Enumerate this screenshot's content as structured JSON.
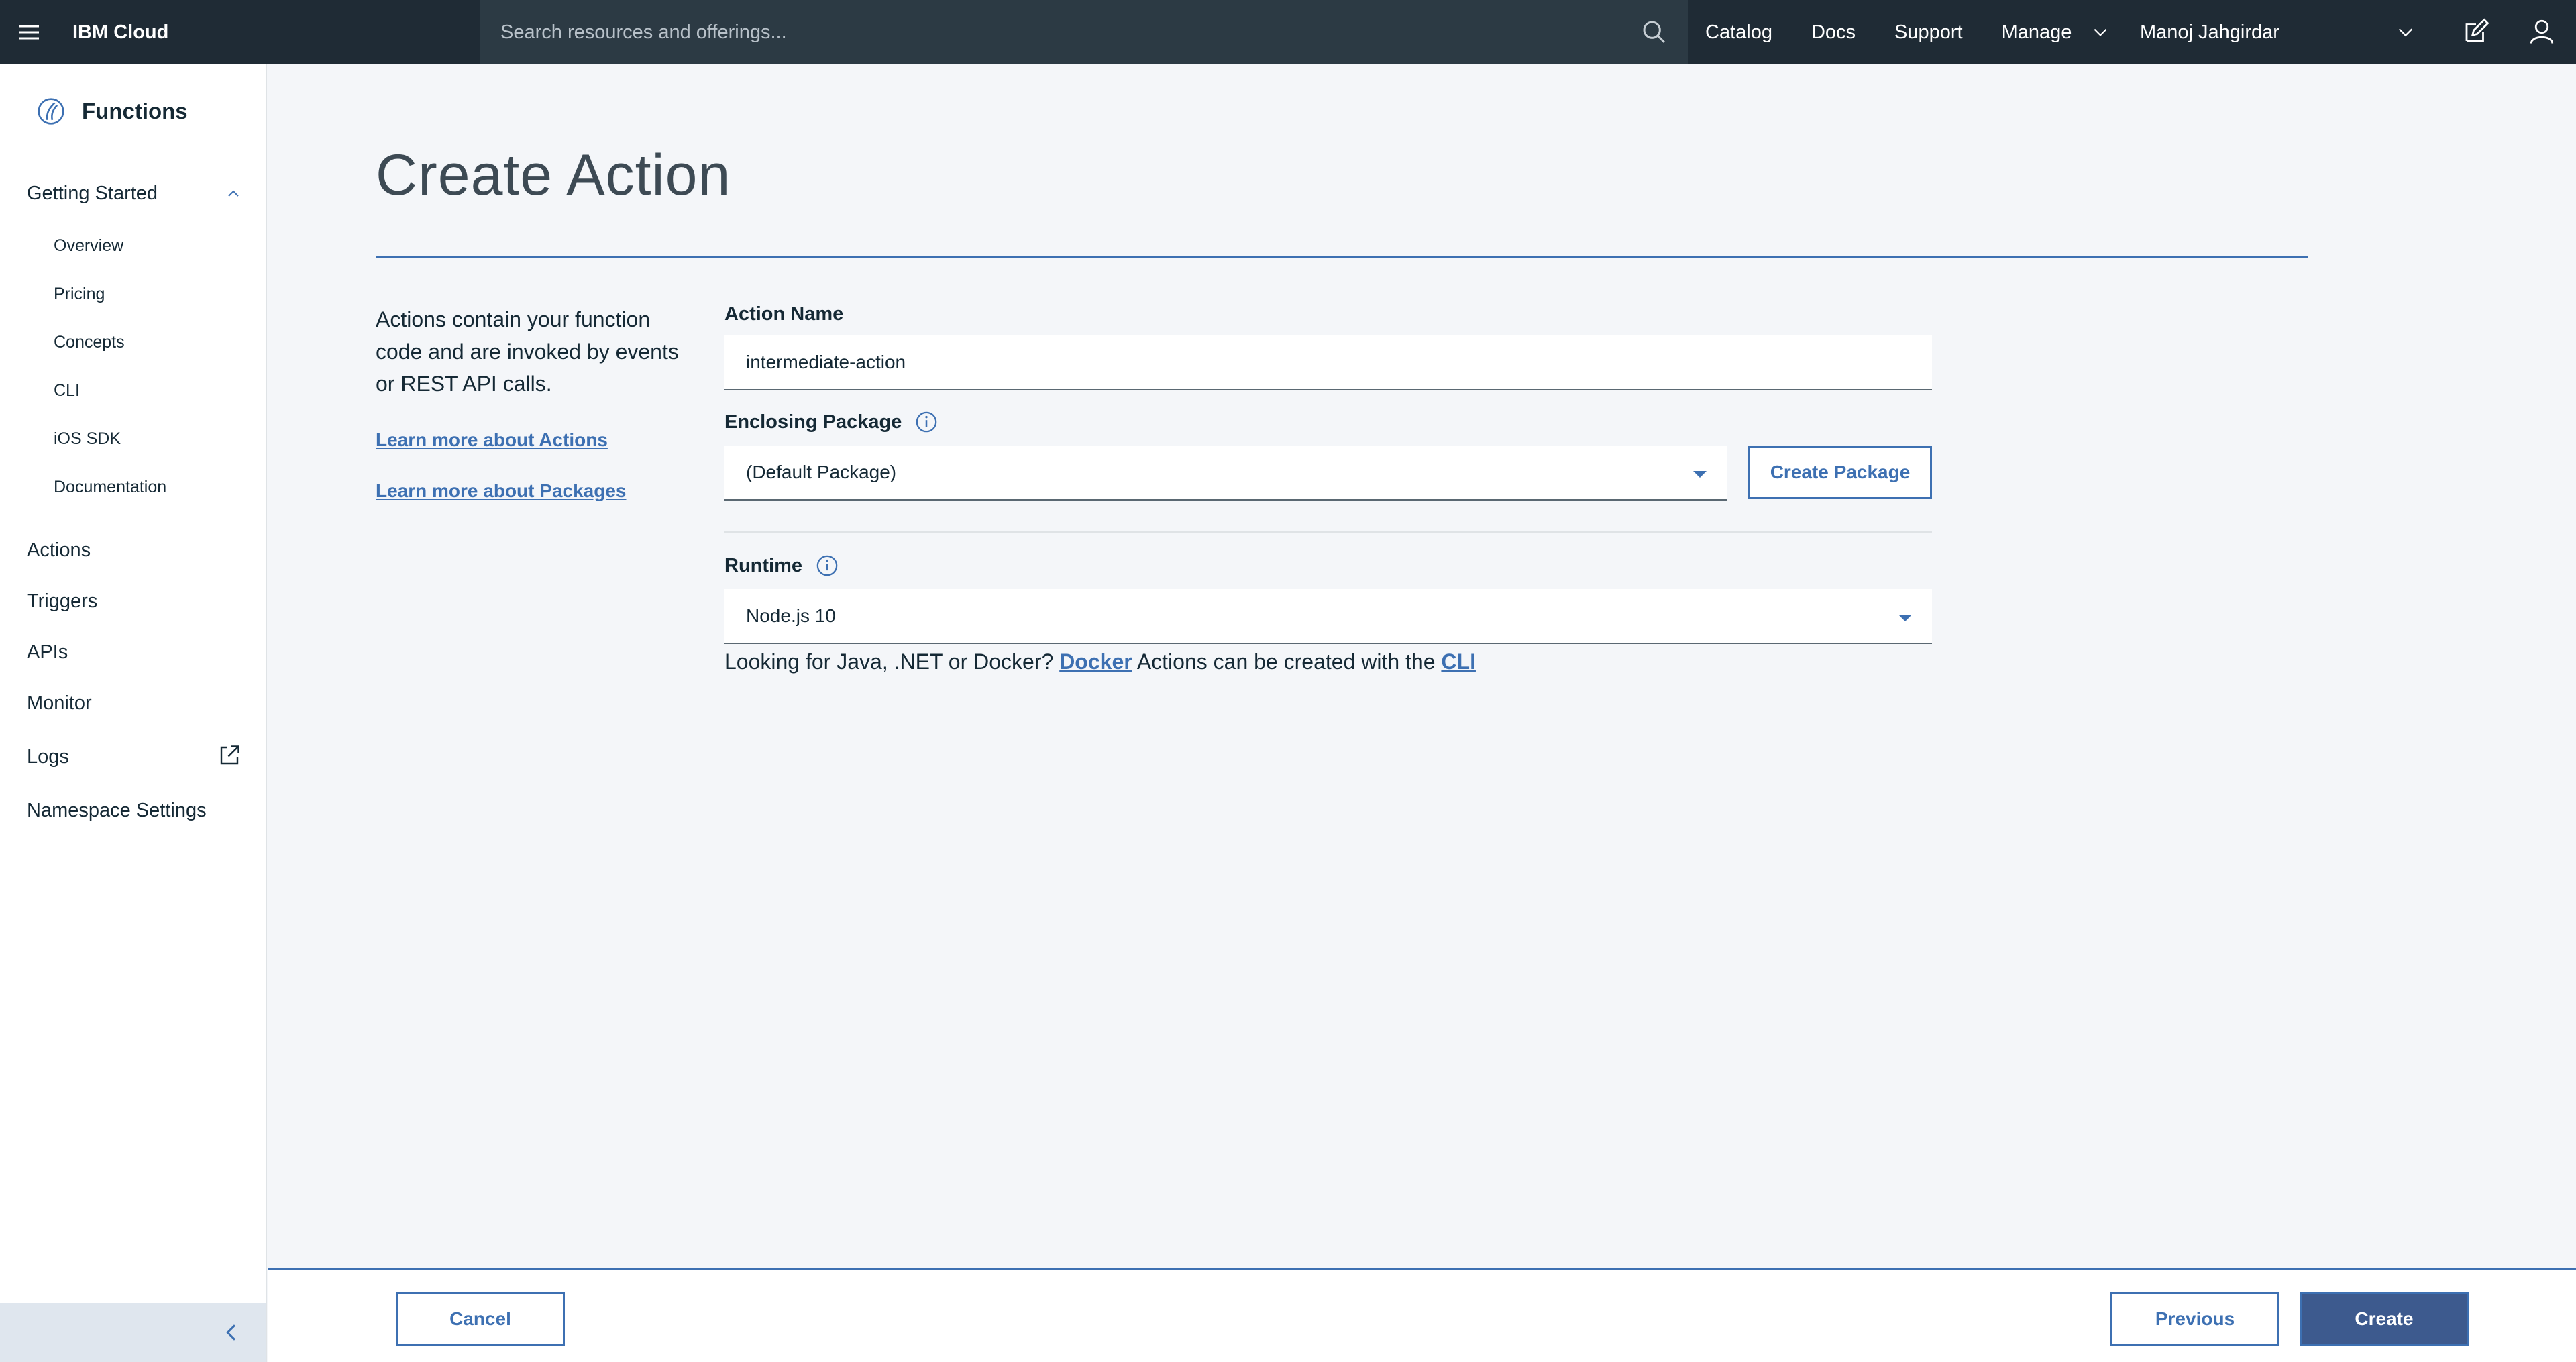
{
  "header": {
    "brand": "IBM Cloud",
    "search_placeholder": "Search resources and offerings...",
    "nav": {
      "catalog": "Catalog",
      "docs": "Docs",
      "support": "Support",
      "manage": "Manage"
    },
    "account": "Manoj Jahgirdar",
    "icons": [
      "menu-icon",
      "search-icon",
      "chevron-down-icon",
      "edit-icon",
      "user-icon"
    ]
  },
  "sidebar": {
    "title": "Functions",
    "group": "Getting Started",
    "sub_items": [
      "Overview",
      "Pricing",
      "Concepts",
      "CLI",
      "iOS SDK",
      "Documentation"
    ],
    "items": [
      "Actions",
      "Triggers",
      "APIs",
      "Monitor",
      "Logs",
      "Namespace Settings"
    ]
  },
  "main": {
    "title": "Create Action",
    "description": "Actions contain your function code and are invoked by events or REST API calls.",
    "learn_actions": "Learn more about Actions",
    "learn_packages": "Learn more about Packages",
    "action_name_label": "Action Name",
    "action_name_value": "intermediate-action",
    "package_label": "Enclosing Package",
    "package_value": "(Default Package)",
    "create_package": "Create Package",
    "runtime_label": "Runtime",
    "runtime_value": "Node.js 10",
    "hint_prefix": "Looking for Java, .NET or Docker?",
    "hint_docker": "Docker",
    "hint_middle": "Actions can be created with the",
    "hint_cli": "CLI"
  },
  "footer": {
    "cancel": "Cancel",
    "previous": "Previous",
    "create": "Create"
  },
  "colors": {
    "header_bg": "#1f2b35",
    "accent": "#3d70b2",
    "primary_button": "#3d5a8e",
    "page_bg": "#f4f6f9"
  }
}
